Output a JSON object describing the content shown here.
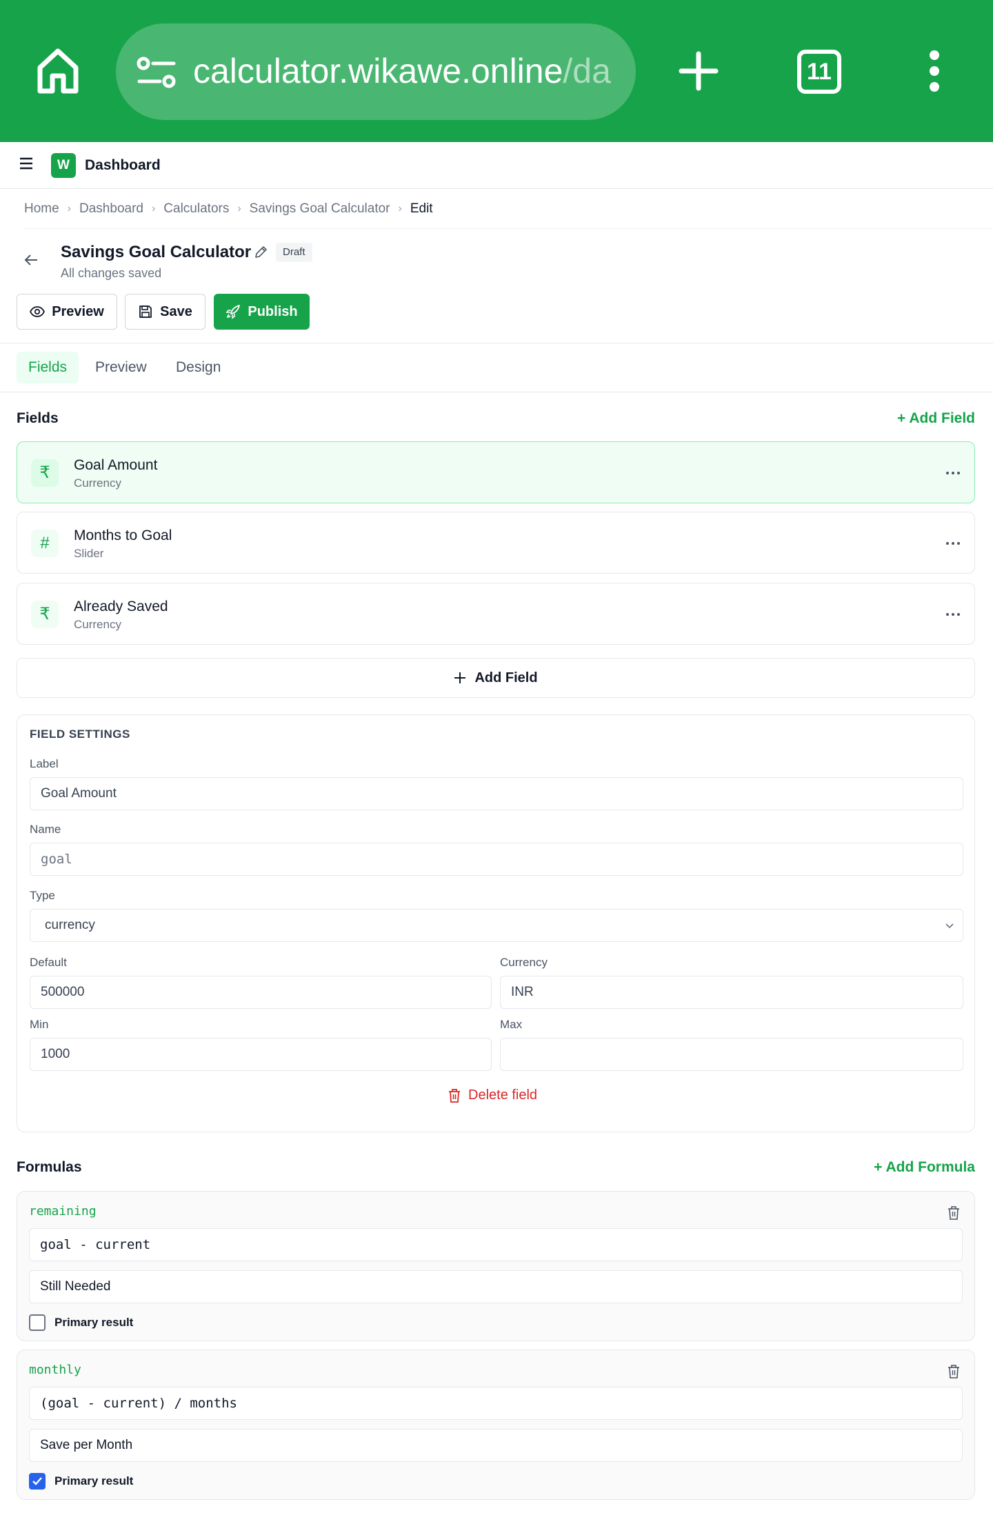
{
  "browser": {
    "url_main": "calculator.wikawe.online",
    "url_faded": "/da",
    "tab_count": "11"
  },
  "app": {
    "logo_letter": "W",
    "title": "Dashboard"
  },
  "breadcrumb": [
    "Home",
    "Dashboard",
    "Calculators",
    "Savings Goal Calculator",
    "Edit"
  ],
  "page": {
    "title": "Savings Goal Calculator",
    "status_badge": "Draft",
    "save_status": "All changes saved"
  },
  "toolbar": {
    "preview_label": "Preview",
    "save_label": "Save",
    "publish_label": "Publish"
  },
  "tabs": [
    {
      "label": "Fields",
      "active": true
    },
    {
      "label": "Preview",
      "active": false
    },
    {
      "label": "Design",
      "active": false
    }
  ],
  "fields_section": {
    "title": "Fields",
    "add_link": "+ Add Field",
    "items": [
      {
        "name": "Goal Amount",
        "type": "Currency",
        "icon": "₹",
        "selected": true
      },
      {
        "name": "Months to Goal",
        "type": "Slider",
        "icon": "#",
        "selected": false
      },
      {
        "name": "Already Saved",
        "type": "Currency",
        "icon": "₹",
        "selected": false
      }
    ],
    "add_button": "Add Field"
  },
  "field_settings": {
    "heading": "FIELD SETTINGS",
    "label_label": "Label",
    "label_value": "Goal Amount",
    "name_label": "Name",
    "name_value": "goal",
    "type_label": "Type",
    "type_value": "currency",
    "default_label": "Default",
    "default_value": "500000",
    "currency_label": "Currency",
    "currency_value": "INR",
    "min_label": "Min",
    "min_value": "1000",
    "max_label": "Max",
    "max_value": "",
    "delete_label": "Delete field"
  },
  "formulas_section": {
    "title": "Formulas",
    "add_link": "+ Add Formula",
    "items": [
      {
        "name": "remaining",
        "expression": "goal - current",
        "label": "Still Needed",
        "primary_label": "Primary result",
        "primary": false
      },
      {
        "name": "monthly",
        "expression": "(goal - current) / months",
        "label": "Save per Month",
        "primary_label": "Primary result",
        "primary": true
      }
    ]
  },
  "colors": {
    "brand_green": "#16a34a",
    "danger_red": "#dc2626",
    "checkbox_blue": "#2563eb"
  }
}
